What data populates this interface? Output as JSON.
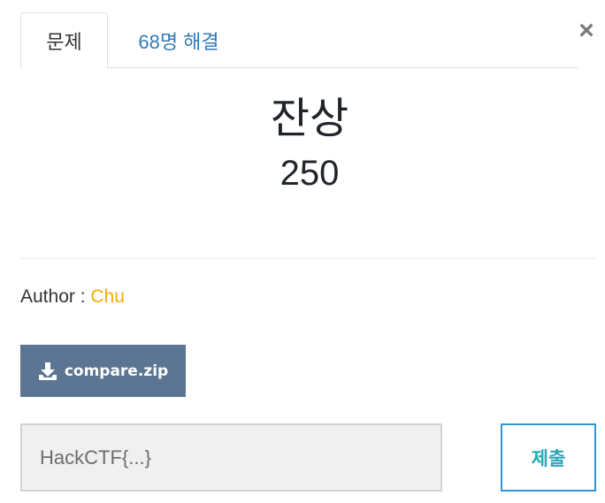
{
  "tabs": [
    {
      "label": "문제",
      "active": true
    },
    {
      "label": "68명 해결",
      "active": false
    }
  ],
  "close_label": "×",
  "challenge": {
    "name": "잔상",
    "value": "250",
    "author_label": "Author : ",
    "author_name": "Chu"
  },
  "file": {
    "label": "compare.zip",
    "icon": "download-icon"
  },
  "flag": {
    "placeholder": "HackCTF{...}",
    "value": ""
  },
  "submit_label": "제출",
  "colors": {
    "link": "#337ab7",
    "author": "#f0ad00",
    "download_bg": "#5c7592",
    "submit_border": "#2f96d6",
    "submit_text": "#2aa7b7"
  }
}
